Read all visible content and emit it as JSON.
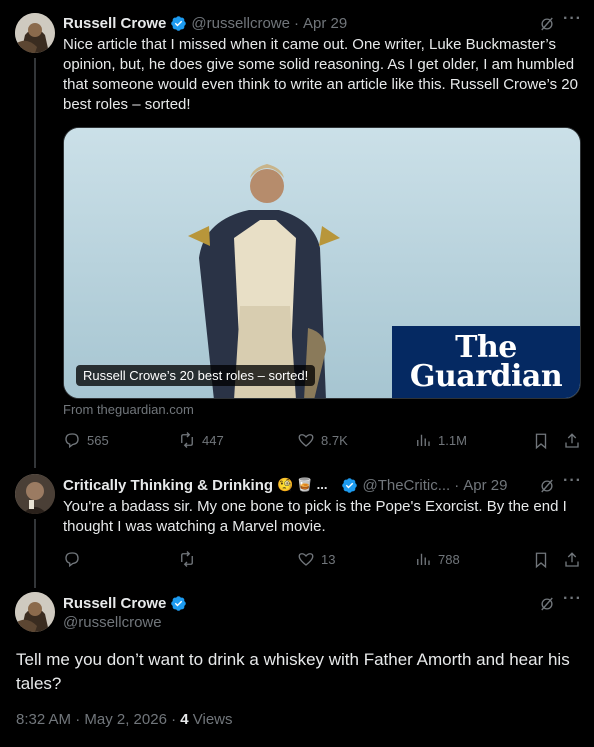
{
  "tweet1": {
    "name": "Russell Crowe",
    "handle": "@russellcrowe",
    "sep": "·",
    "date": "Apr 29",
    "text": "Nice article that I missed when it came out. One writer, Luke Buckmaster’s opinion, but, he does give some solid reasoning. As I get older, I am humbled that someone would even think to write an article like this. Russell Crowe’s 20 best roles – sorted!",
    "card": {
      "caption": "Russell Crowe’s 20 best roles – sorted!",
      "logo_line1": "The",
      "logo_line2": "Guardian",
      "source": "From theguardian.com"
    },
    "stats": {
      "replies": "565",
      "reposts": "447",
      "likes": "8.7K",
      "views": "1.1M"
    }
  },
  "tweet2": {
    "name": "Critically Thinking & Drinking",
    "emoji": "🧐 🥃 ...",
    "handle": "@TheCritic...",
    "sep": "·",
    "date": "Apr 29",
    "text": "You're a badass sir. My one bone to pick is the Pope's Exorcist. By the end I thought I was watching a Marvel movie.",
    "stats": {
      "likes": "13",
      "views": "788"
    }
  },
  "main": {
    "name": "Russell Crowe",
    "handle": "@russellcrowe",
    "text": "Tell me you don’t want to drink a whiskey with Father Amorth and hear his tales?",
    "time": "8:32 AM · May 2, 2026 · ",
    "views_count": "4",
    "views_label": " Views"
  },
  "icons": {
    "verified": "verified-badge-icon",
    "grok": "grok-icon",
    "more": "more-icon",
    "reply": "reply-icon",
    "repost": "repost-icon",
    "like": "like-icon",
    "views": "views-icon",
    "bookmark": "bookmark-icon",
    "share": "share-icon"
  },
  "colors": {
    "background": "#000000",
    "text": "#e7e9ea",
    "muted": "#71767b",
    "verified": "#1d9bf0",
    "guardian": "#052962"
  }
}
